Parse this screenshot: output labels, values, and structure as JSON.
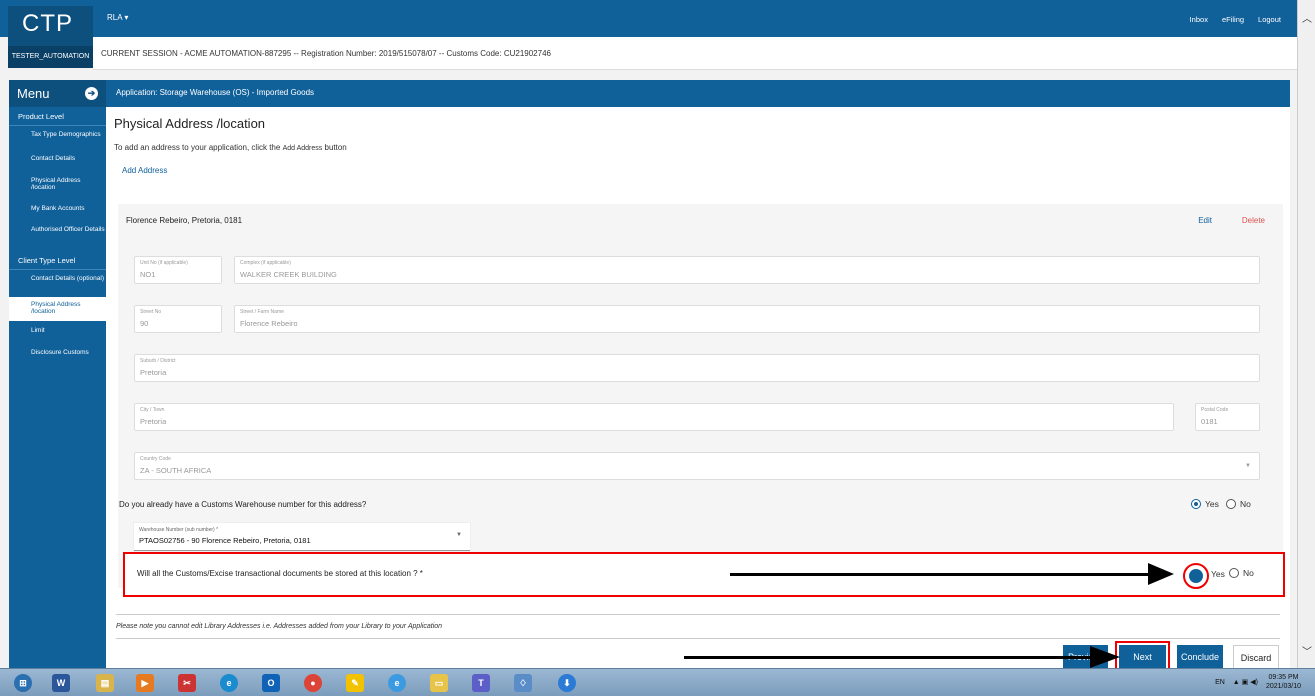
{
  "header": {
    "logo": "CTP",
    "user": "TESTER_AUTOMATION",
    "account_menu": "RLA",
    "links": [
      "Inbox",
      "eFiling",
      "Logout"
    ]
  },
  "session": {
    "text": "CURRENT SESSION - ACME AUTOMATION-887295 -- Registration Number: 2019/515078/07 -- Customs Code: CU21902746"
  },
  "sidebar": {
    "title": "Menu",
    "product_level": "Product Level",
    "product_items": [
      "Tax Type Demographics",
      "Contact Details",
      "Physical Address /location",
      "My Bank Accounts",
      "Authorised Officer Details"
    ],
    "client_level": "Client Type Level",
    "client_items": [
      "Contact Details (optional)",
      "Physical Address /location",
      "Limit",
      "Disclosure Customs"
    ]
  },
  "main": {
    "application": "Application: Storage Warehouse (OS) - Imported Goods",
    "title": "Physical Address /location",
    "intro_prefix": "To add an address to your application, click the",
    "intro_button": "Add Address",
    "intro_suffix": "button",
    "add_address": "Add Address"
  },
  "address": {
    "title": "Florence Rebeiro, Pretoria, 0181",
    "edit": "Edit",
    "delete": "Delete",
    "fields": {
      "unit_label": "Unit No (if applicable)",
      "unit_value": "NO1",
      "complex_label": "Complex (if applicable)",
      "complex_value": "WALKER CREEK BUILDING",
      "street_no_label": "Street No",
      "street_no_value": "90",
      "street_name_label": "Street / Farm Name",
      "street_name_value": "Florence Rebeiro",
      "suburb_label": "Suburb / District",
      "suburb_value": "Pretoria",
      "city_label": "City / Town",
      "city_value": "Pretoria",
      "postal_label": "Postal Code",
      "postal_value": "0181",
      "country_label": "Country Code",
      "country_value": "ZA - SOUTH AFRICA"
    },
    "q1": "Do you already have a Customs Warehouse number for this address?",
    "q1_selected": "Yes",
    "warehouse_label": "Warehouse Number (sub number) *",
    "warehouse_value": "PTAOS02756 - 90 Florence Rebeiro, Pretoria, 0181"
  },
  "question2": {
    "text": "Will all the Customs/Excise transactional documents be stored at this location ? *",
    "yes_visible": "Yes",
    "no": "No",
    "selected": "Yes"
  },
  "radio_labels": {
    "yes": "Yes",
    "no": "No"
  },
  "note": "Please note  you cannot edit Library Addresses i.e. Addresses added from your Library to your Application",
  "buttons": {
    "previous": "Previous",
    "next": "Next",
    "conclude": "Conclude",
    "discard": "Discard"
  },
  "taskbar": {
    "lang": "EN",
    "time": "09:35 PM",
    "date": "2021/03/10"
  },
  "colors": {
    "primary": "#10609a",
    "danger": "#d9534f",
    "highlight": "#e00000"
  }
}
